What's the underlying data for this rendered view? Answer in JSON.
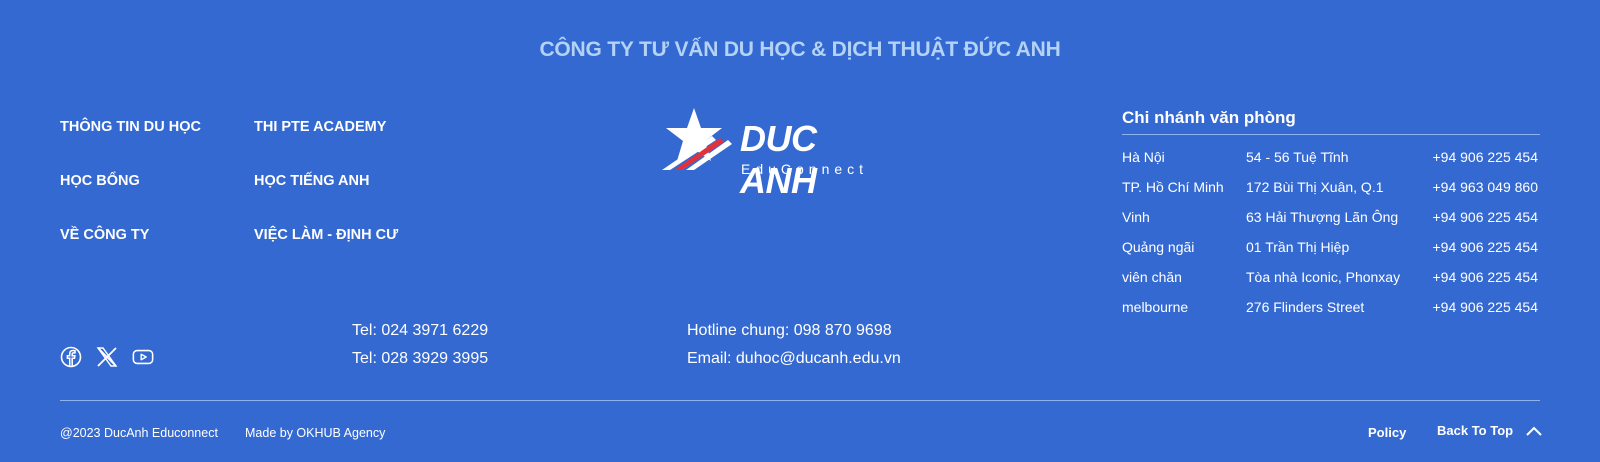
{
  "company_title": "CÔNG TY TƯ VẤN DU HỌC & DỊCH THUẬT ĐỨC ANH",
  "nav": {
    "col1": [
      "THÔNG TIN DU HỌC",
      "HỌC BỔNG",
      "VỀ CÔNG TY"
    ],
    "col2": [
      "THI PTE ACADEMY",
      "HỌC TIẾNG ANH",
      "VIỆC LÀM - ĐỊNH CƯ"
    ]
  },
  "logo": {
    "brand": "DUC ANH",
    "tagline": "EduConnect"
  },
  "branches": {
    "heading": "Chi nhánh văn phòng",
    "rows": [
      {
        "city": "Hà Nội",
        "address": "54 - 56 Tuệ Tĩnh",
        "phone": "+94 906 225 454"
      },
      {
        "city": "TP. Hồ Chí Minh",
        "address": "172 Bùi Thị Xuân, Q.1",
        "phone": "+94 963 049 860"
      },
      {
        "city": "Vinh",
        "address": "63 Hải Thượng Lãn Ông",
        "phone": "+94 906 225 454"
      },
      {
        "city": "Quảng ngãi",
        "address": "01 Trần Thị Hiệp",
        "phone": "+94 906 225 454"
      },
      {
        "city": "viên chăn",
        "address": "Tòa nhà Iconic, Phonxay",
        "phone": "+94 906 225 454"
      },
      {
        "city": "melbourne",
        "address": "276 Flinders Street",
        "phone": "+94 906 225 454"
      }
    ]
  },
  "social": [
    "facebook-icon",
    "x-twitter-icon",
    "youtube-icon"
  ],
  "contact": {
    "tel1": "Tel: 024 3971 6229",
    "tel2": "Tel: 028 3929 3995",
    "hotline": "Hotline chung: 098 870 9698",
    "email": "Email: duhoc@ducanh.edu.vn"
  },
  "footer": {
    "copyright": "@2023 DucAnh Educonnect",
    "made_by": "Made by OKHUB Agency",
    "policy": "Policy",
    "back_to_top": "Back To Top"
  },
  "colors": {
    "background": "#3469d1",
    "title": "#b3d2f6",
    "logo_red": "#e0323c"
  }
}
